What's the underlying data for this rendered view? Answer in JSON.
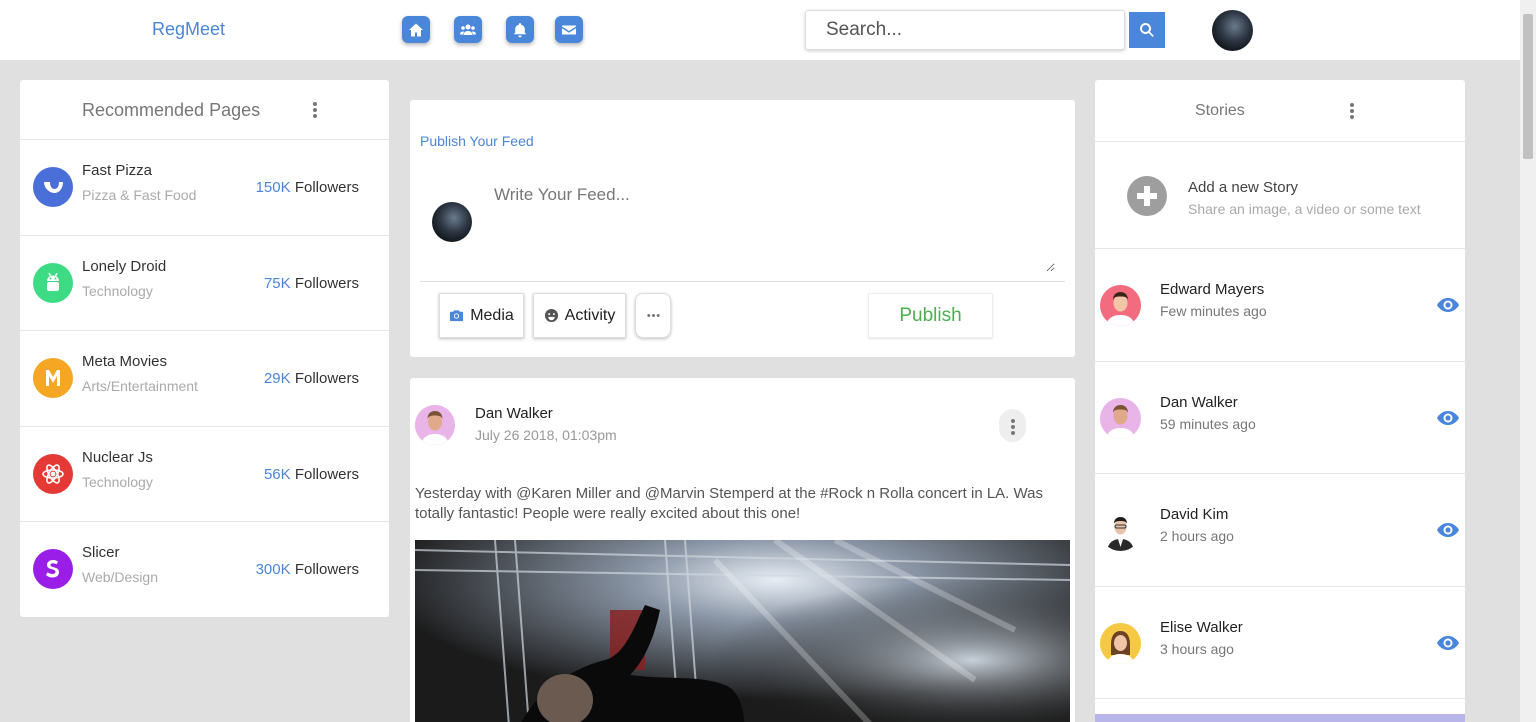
{
  "app": {
    "brand": "RegMeet"
  },
  "header": {
    "nav": [
      "home-icon",
      "groups-icon",
      "bell-icon",
      "envelope-icon"
    ],
    "search_placeholder": "Search...",
    "accent_color": "#4a86d9"
  },
  "recommended": {
    "title": "Recommended Pages",
    "pages": [
      {
        "name": "Fast Pizza",
        "category": "Pizza & Fast Food",
        "count": "150K",
        "followers_label": "Followers",
        "color": "#4a6fd8",
        "icon": "pizza-logo-icon"
      },
      {
        "name": "Lonely Droid",
        "category": "Technology",
        "count": "75K",
        "followers_label": "Followers",
        "color": "#3ddc84",
        "icon": "android-logo-icon"
      },
      {
        "name": "Meta Movies",
        "category": "Arts/Entertainment",
        "count": "29K",
        "followers_label": "Followers",
        "color": "#f5a623",
        "icon": "movie-logo-icon"
      },
      {
        "name": "Nuclear Js",
        "category": "Technology",
        "count": "56K",
        "followers_label": "Followers",
        "color": "#e53935",
        "icon": "atom-logo-icon"
      },
      {
        "name": "Slicer",
        "category": "Web/Design",
        "count": "300K",
        "followers_label": "Followers",
        "color": "#9b1ee8",
        "icon": "slicer-logo-icon"
      }
    ]
  },
  "publish": {
    "title": "Publish Your Feed",
    "placeholder": "Write Your Feed...",
    "media_label": "Media",
    "activity_label": "Activity",
    "publish_label": "Publish"
  },
  "post": {
    "author": "Dan Walker",
    "time": "July 26 2018, 01:03pm",
    "text": "Yesterday with @Karen Miller and @Marvin Stemperd at the #Rock n Rolla concert in LA. Was totally fantastic! People were really excited about this one!"
  },
  "stories": {
    "title": "Stories",
    "add_title": "Add a new Story",
    "add_subtitle": "Share an image, a video or some text",
    "items": [
      {
        "name": "Edward Mayers",
        "time": "Few minutes ago",
        "avatar_color": "#f36b7f"
      },
      {
        "name": "Dan Walker",
        "time": "59 minutes ago",
        "avatar_color": "#e9b4e8"
      },
      {
        "name": "David Kim",
        "time": "2 hours ago",
        "avatar_color": "#ffffff"
      },
      {
        "name": "Elise Walker",
        "time": "3 hours ago",
        "avatar_color": "#f6c945"
      }
    ]
  }
}
